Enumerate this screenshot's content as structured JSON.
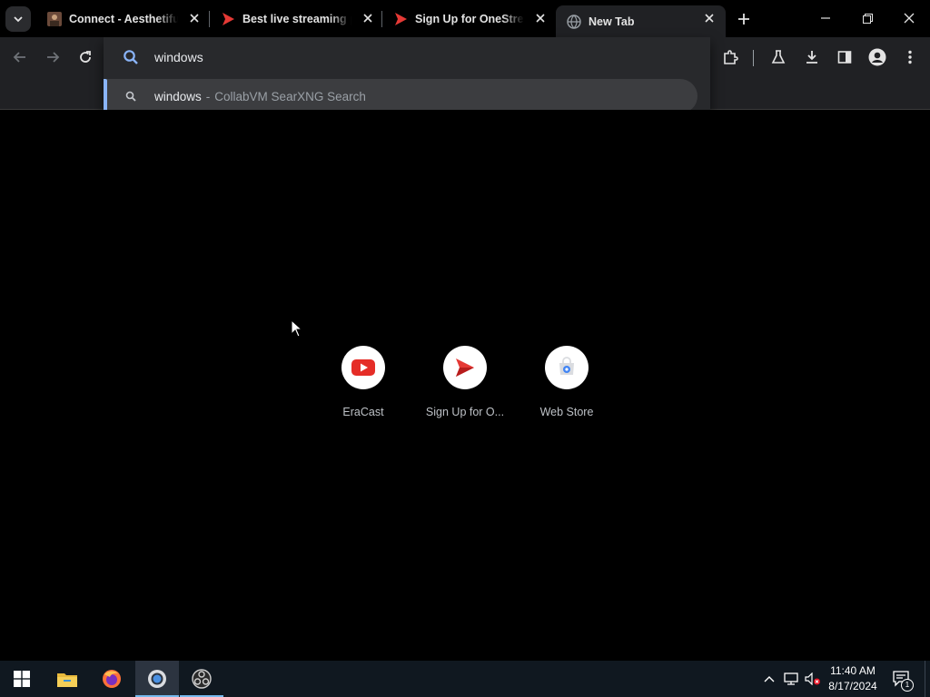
{
  "tabs": [
    {
      "title": "Connect - Aesthetiful",
      "favicon": "avatar-favicon",
      "active": false
    },
    {
      "title": "Best live streaming pl",
      "favicon": "red-play-favicon",
      "active": false
    },
    {
      "title": "Sign Up for OneStream",
      "favicon": "red-play-favicon",
      "active": false
    },
    {
      "title": "New Tab",
      "favicon": "globe-favicon",
      "active": true
    }
  ],
  "omnibox": {
    "value": "windows",
    "suggestion": {
      "query": "windows",
      "separator": "-",
      "engine": "CollabVM SearXNG Search"
    }
  },
  "shortcuts": [
    {
      "label": "EraCast",
      "icon": "youtube-icon"
    },
    {
      "label": "Sign Up for O...",
      "icon": "onestream-icon"
    },
    {
      "label": "Web Store",
      "icon": "web-store-icon"
    }
  ],
  "taskbar": {
    "apps": [
      "start-icon",
      "file-explorer-icon",
      "firefox-icon",
      "chrome-icon",
      "obs-icon"
    ],
    "active_app": "chrome-icon",
    "clock": {
      "time": "11:40 AM",
      "date": "8/17/2024"
    },
    "notification_count": "1"
  },
  "colors": {
    "background": "#000000",
    "toolbar": "#202124",
    "accent": "#8ab4f8",
    "taskbar": "#101820"
  }
}
